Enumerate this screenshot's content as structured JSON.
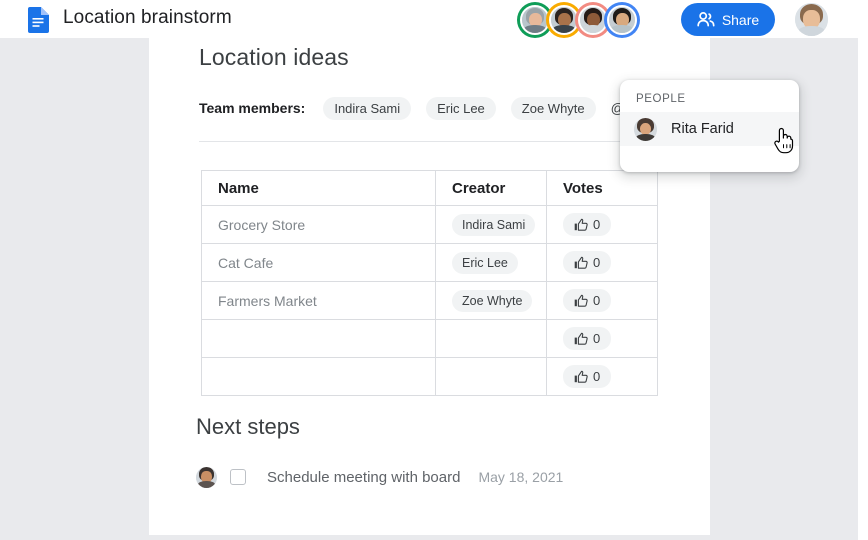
{
  "header": {
    "doc_icon": "google-docs-icon",
    "title": "Location brainstorm",
    "share_label": "Share",
    "share_icon": "people-group-icon",
    "share_color": "#1a73e8",
    "collaborators": [
      {
        "ring_color": "#0f9d58",
        "name": "collaborator-1"
      },
      {
        "ring_color": "#f9ab00",
        "name": "collaborator-2"
      },
      {
        "ring_color": "#f28b82",
        "name": "collaborator-3"
      },
      {
        "ring_color": "#4285f4",
        "name": "collaborator-4"
      }
    ],
    "account_avatar": "account-avatar"
  },
  "document": {
    "heading1": "Location ideas",
    "team_members_label": "Team members:",
    "team_members": [
      "Indira Sami",
      "Eric Lee",
      "Zoe Whyte"
    ],
    "mention_text": "@Rita",
    "table": {
      "columns": [
        "Name",
        "Creator",
        "Votes"
      ],
      "rows": [
        {
          "name": "Grocery Store",
          "creator": "Indira Sami",
          "votes": "0"
        },
        {
          "name": "Cat Cafe",
          "creator": "Eric Lee",
          "votes": "0"
        },
        {
          "name": "Farmers Market",
          "creator": "Zoe Whyte",
          "votes": "0"
        },
        {
          "name": "",
          "creator": "",
          "votes": "0"
        },
        {
          "name": "",
          "creator": "",
          "votes": "0"
        }
      ],
      "vote_icon": "thumbs-up-icon"
    },
    "heading2": "Next steps",
    "task": {
      "text": "Schedule meeting with board",
      "date": "May 18, 2021",
      "checked": false,
      "avatar": "task-assignee-avatar"
    }
  },
  "mention_popup": {
    "section_label": "PEOPLE",
    "items": [
      {
        "name": "Rita Farid",
        "avatar": "person-avatar"
      }
    ]
  },
  "cursor": {
    "icon": "hand-pointer-cursor"
  }
}
